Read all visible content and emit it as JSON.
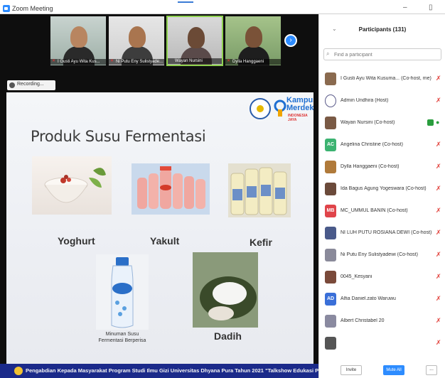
{
  "window": {
    "title": "Zoom Meeting",
    "minimize": "–",
    "maximize": "▯"
  },
  "gallery": {
    "tiles": [
      {
        "name": "I Gusti Ayu Wita Kus...",
        "active": false
      },
      {
        "name": "Ni Putu Eny Sulistyade...",
        "active": false
      },
      {
        "name": "Wayan Nursini",
        "active": true
      },
      {
        "name": "Dylla Hanggaeni",
        "active": false
      }
    ],
    "next_icon": "chevron-right-icon"
  },
  "recording": {
    "label": "Recording..."
  },
  "slide": {
    "title": "Produk Susu Fermentasi",
    "logo_line1": "Kampus",
    "logo_line2": "Merdeka",
    "logo_line3": "INDONESIA JAYA",
    "products": [
      {
        "label": "Yoghurt"
      },
      {
        "label": "Yakult"
      },
      {
        "label": "Kefir"
      },
      {
        "label": "Dadih"
      }
    ],
    "calpico_caption_line1": "Minuman Susu",
    "calpico_caption_line2": "Fermentasi Berperisa",
    "banner": "Pengabdian Kepada Masyarakat Program Studi Ilmu Gizi Universitas Dhyana Pura Tahun 2021 \"Talkshow Edukasi Pangan dan Gizi\""
  },
  "participants": {
    "title": "Participants (131)",
    "search_placeholder": "Find a participant",
    "list": [
      {
        "name": "I Gusti Ayu Wita Kusuma... (Co-host, me)",
        "avatar": "photo",
        "color": "#8a6a4f",
        "mic": "off",
        "video": false
      },
      {
        "name": "Admin Undhira (Host)",
        "avatar": "logo",
        "color": "#5a5a8a",
        "mic": "off",
        "video": false
      },
      {
        "name": "Wayan Nursini (Co-host)",
        "avatar": "photo",
        "color": "#7a5a45",
        "mic": "on",
        "video": true
      },
      {
        "name": "Angelina Christine (Co-host)",
        "avatar": "AC",
        "color": "#3cb371",
        "mic": "off",
        "video": false
      },
      {
        "name": "Dylla Hanggaeni (Co-host)",
        "avatar": "photo",
        "color": "#b07a3a",
        "mic": "off",
        "video": false
      },
      {
        "name": "Ida Bagus Agung Yogeswara (Co-host)",
        "avatar": "photo",
        "color": "#6b4a3a",
        "mic": "off",
        "video": false
      },
      {
        "name": "MC_UMMUL BANIN (Co-host)",
        "avatar": "MB",
        "color": "#e0444a",
        "mic": "off",
        "video": false
      },
      {
        "name": "NI LUH PUTU ROSIANA DEWI (Co-host)",
        "avatar": "photo",
        "color": "#4a5a8a",
        "mic": "off",
        "video": false
      },
      {
        "name": "Ni Putu Eny Sulistyadewi (Co-host)",
        "avatar": "photo",
        "color": "#8a8a9a",
        "mic": "off",
        "video": false
      },
      {
        "name": "0045_Kesyani",
        "avatar": "photo",
        "color": "#7a4a3a",
        "mic": "off",
        "video": false
      },
      {
        "name": "Alfia Daniel.zato Waruwu",
        "avatar": "AD",
        "color": "#3a6fd8",
        "mic": "off",
        "video": false
      },
      {
        "name": "Albert Christabel 20",
        "avatar": "photo",
        "color": "#8a8aa0",
        "mic": "off",
        "video": false
      },
      {
        "name": "",
        "avatar": "photo",
        "color": "#555555",
        "mic": "off",
        "video": false
      }
    ],
    "invite_label": "Invite",
    "mute_all_label": "Mute All",
    "more_label": "..."
  }
}
